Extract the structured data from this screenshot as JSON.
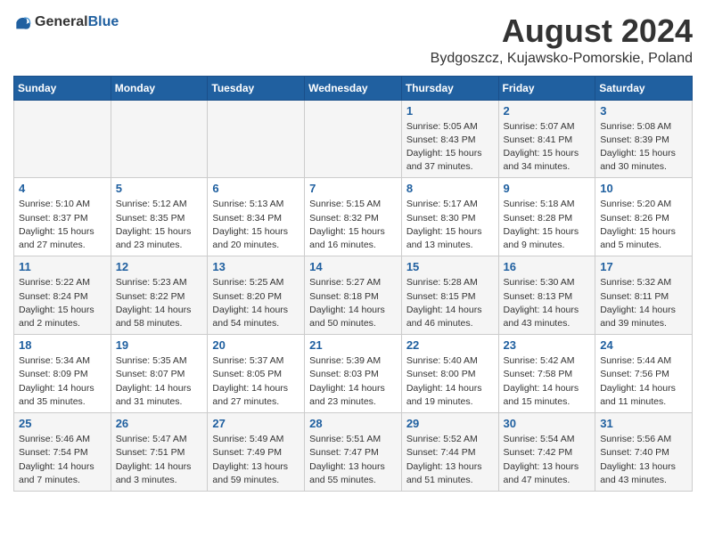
{
  "logo": {
    "general": "General",
    "blue": "Blue"
  },
  "title": {
    "month_year": "August 2024",
    "location": "Bydgoszcz, Kujawsko-Pomorskie, Poland"
  },
  "days_of_week": [
    "Sunday",
    "Monday",
    "Tuesday",
    "Wednesday",
    "Thursday",
    "Friday",
    "Saturday"
  ],
  "weeks": [
    [
      {
        "day": "",
        "info": ""
      },
      {
        "day": "",
        "info": ""
      },
      {
        "day": "",
        "info": ""
      },
      {
        "day": "",
        "info": ""
      },
      {
        "day": "1",
        "info": "Sunrise: 5:05 AM\nSunset: 8:43 PM\nDaylight: 15 hours\nand 37 minutes."
      },
      {
        "day": "2",
        "info": "Sunrise: 5:07 AM\nSunset: 8:41 PM\nDaylight: 15 hours\nand 34 minutes."
      },
      {
        "day": "3",
        "info": "Sunrise: 5:08 AM\nSunset: 8:39 PM\nDaylight: 15 hours\nand 30 minutes."
      }
    ],
    [
      {
        "day": "4",
        "info": "Sunrise: 5:10 AM\nSunset: 8:37 PM\nDaylight: 15 hours\nand 27 minutes."
      },
      {
        "day": "5",
        "info": "Sunrise: 5:12 AM\nSunset: 8:35 PM\nDaylight: 15 hours\nand 23 minutes."
      },
      {
        "day": "6",
        "info": "Sunrise: 5:13 AM\nSunset: 8:34 PM\nDaylight: 15 hours\nand 20 minutes."
      },
      {
        "day": "7",
        "info": "Sunrise: 5:15 AM\nSunset: 8:32 PM\nDaylight: 15 hours\nand 16 minutes."
      },
      {
        "day": "8",
        "info": "Sunrise: 5:17 AM\nSunset: 8:30 PM\nDaylight: 15 hours\nand 13 minutes."
      },
      {
        "day": "9",
        "info": "Sunrise: 5:18 AM\nSunset: 8:28 PM\nDaylight: 15 hours\nand 9 minutes."
      },
      {
        "day": "10",
        "info": "Sunrise: 5:20 AM\nSunset: 8:26 PM\nDaylight: 15 hours\nand 5 minutes."
      }
    ],
    [
      {
        "day": "11",
        "info": "Sunrise: 5:22 AM\nSunset: 8:24 PM\nDaylight: 15 hours\nand 2 minutes."
      },
      {
        "day": "12",
        "info": "Sunrise: 5:23 AM\nSunset: 8:22 PM\nDaylight: 14 hours\nand 58 minutes."
      },
      {
        "day": "13",
        "info": "Sunrise: 5:25 AM\nSunset: 8:20 PM\nDaylight: 14 hours\nand 54 minutes."
      },
      {
        "day": "14",
        "info": "Sunrise: 5:27 AM\nSunset: 8:18 PM\nDaylight: 14 hours\nand 50 minutes."
      },
      {
        "day": "15",
        "info": "Sunrise: 5:28 AM\nSunset: 8:15 PM\nDaylight: 14 hours\nand 46 minutes."
      },
      {
        "day": "16",
        "info": "Sunrise: 5:30 AM\nSunset: 8:13 PM\nDaylight: 14 hours\nand 43 minutes."
      },
      {
        "day": "17",
        "info": "Sunrise: 5:32 AM\nSunset: 8:11 PM\nDaylight: 14 hours\nand 39 minutes."
      }
    ],
    [
      {
        "day": "18",
        "info": "Sunrise: 5:34 AM\nSunset: 8:09 PM\nDaylight: 14 hours\nand 35 minutes."
      },
      {
        "day": "19",
        "info": "Sunrise: 5:35 AM\nSunset: 8:07 PM\nDaylight: 14 hours\nand 31 minutes."
      },
      {
        "day": "20",
        "info": "Sunrise: 5:37 AM\nSunset: 8:05 PM\nDaylight: 14 hours\nand 27 minutes."
      },
      {
        "day": "21",
        "info": "Sunrise: 5:39 AM\nSunset: 8:03 PM\nDaylight: 14 hours\nand 23 minutes."
      },
      {
        "day": "22",
        "info": "Sunrise: 5:40 AM\nSunset: 8:00 PM\nDaylight: 14 hours\nand 19 minutes."
      },
      {
        "day": "23",
        "info": "Sunrise: 5:42 AM\nSunset: 7:58 PM\nDaylight: 14 hours\nand 15 minutes."
      },
      {
        "day": "24",
        "info": "Sunrise: 5:44 AM\nSunset: 7:56 PM\nDaylight: 14 hours\nand 11 minutes."
      }
    ],
    [
      {
        "day": "25",
        "info": "Sunrise: 5:46 AM\nSunset: 7:54 PM\nDaylight: 14 hours\nand 7 minutes."
      },
      {
        "day": "26",
        "info": "Sunrise: 5:47 AM\nSunset: 7:51 PM\nDaylight: 14 hours\nand 3 minutes."
      },
      {
        "day": "27",
        "info": "Sunrise: 5:49 AM\nSunset: 7:49 PM\nDaylight: 13 hours\nand 59 minutes."
      },
      {
        "day": "28",
        "info": "Sunrise: 5:51 AM\nSunset: 7:47 PM\nDaylight: 13 hours\nand 55 minutes."
      },
      {
        "day": "29",
        "info": "Sunrise: 5:52 AM\nSunset: 7:44 PM\nDaylight: 13 hours\nand 51 minutes."
      },
      {
        "day": "30",
        "info": "Sunrise: 5:54 AM\nSunset: 7:42 PM\nDaylight: 13 hours\nand 47 minutes."
      },
      {
        "day": "31",
        "info": "Sunrise: 5:56 AM\nSunset: 7:40 PM\nDaylight: 13 hours\nand 43 minutes."
      }
    ]
  ]
}
